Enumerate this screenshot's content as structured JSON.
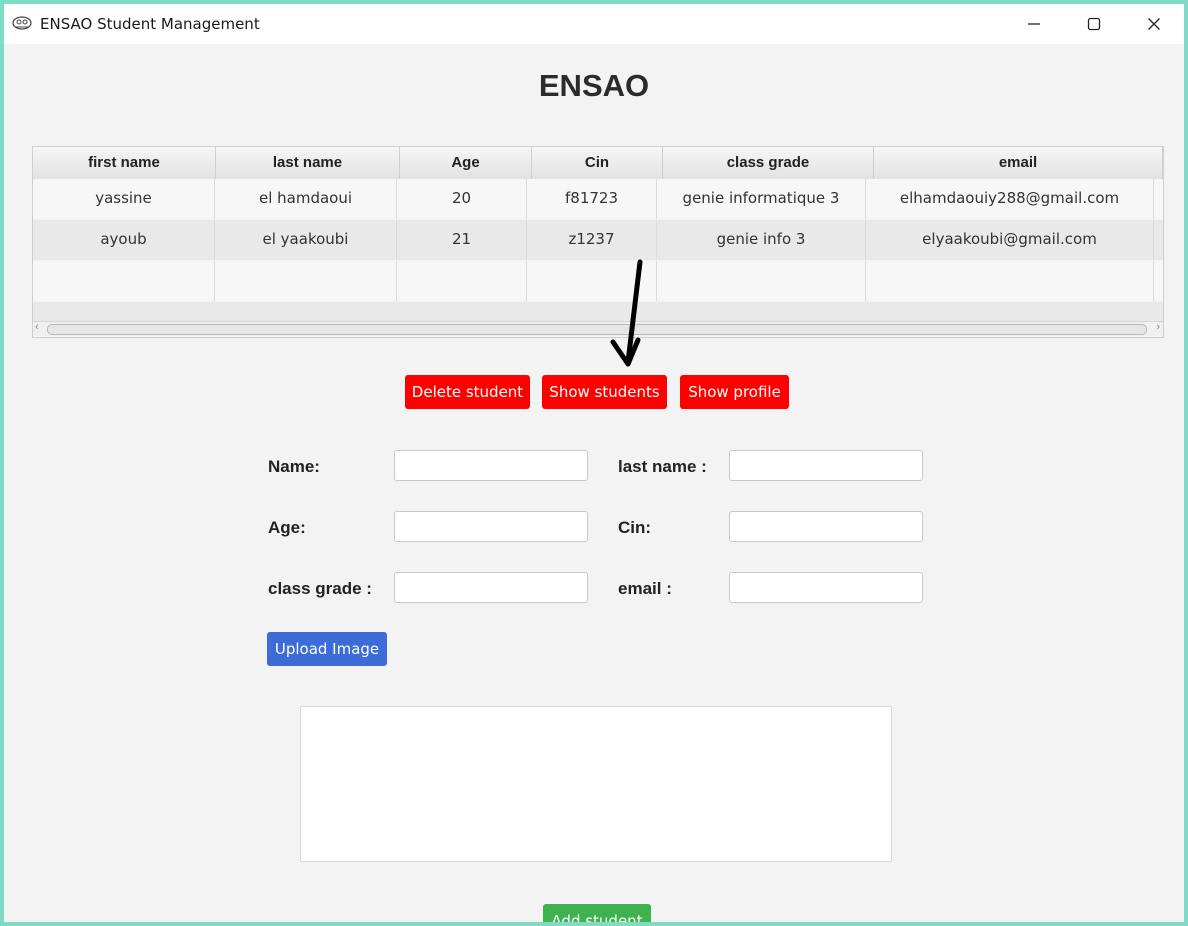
{
  "window": {
    "title": "ENSAO Student Management",
    "icons": {
      "app": "student-logo-icon",
      "minimize": "minimize-icon",
      "maximize": "maximize-icon",
      "close": "close-icon"
    }
  },
  "heading": "ENSAO",
  "table": {
    "columns": [
      "first name",
      "last name",
      "Age",
      "Cin",
      "class grade",
      "email"
    ],
    "rows": [
      [
        "yassine",
        "el hamdaoui",
        "20",
        "f81723",
        "genie informatique 3",
        "elhamdaouiy288@gmail.com"
      ],
      [
        "ayoub",
        "el yaakoubi",
        "21",
        "z1237",
        "genie info 3",
        "elyaakoubi@gmail.com"
      ],
      [
        "",
        "",
        "",
        "",
        "",
        ""
      ]
    ],
    "scroll_left_icon": "‹",
    "scroll_right_icon": "›"
  },
  "actions": {
    "delete_label": "Delete student",
    "show_students_label": "Show students",
    "show_profile_label": "Show profile"
  },
  "form": {
    "name_label": "Name:",
    "last_name_label": "last name :",
    "age_label": "Age:",
    "cin_label": "Cin:",
    "class_grade_label": "class grade :",
    "email_label": "email :",
    "name_value": "",
    "last_name_value": "",
    "age_value": "",
    "cin_value": "",
    "class_grade_value": "",
    "email_value": "",
    "upload_label": "Upload Image",
    "add_label": "Add student"
  },
  "colors": {
    "danger": "#ff0000",
    "primary": "#3d6cd9",
    "success": "#3db24f",
    "desktop": "#7fdcc4"
  }
}
